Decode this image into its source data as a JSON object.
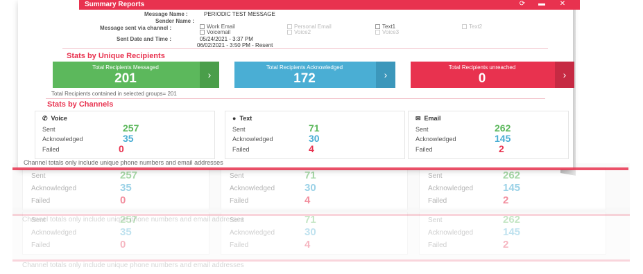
{
  "window": {
    "title": "Summary Reports",
    "icons": [
      "refresh-icon",
      "minimize-icon",
      "close-icon"
    ]
  },
  "meta": {
    "message_name_label": "Message Name :",
    "message_name_value": "PERIODIC TEST MESSAGE",
    "sender_name_label": "Sender Name :",
    "channels_label": "Message sent via channel :",
    "sent_label": "Sent Date and Time :",
    "sent_value_1": "05/24/2021 - 3:37 PM",
    "sent_value_2": "06/02/2021 - 3:50 PM - Resent"
  },
  "channels": {
    "work_email": "Work Email",
    "voicemail": "Voicemail",
    "personal_email": "Personal Email",
    "voice2": "Voice2",
    "text1": "Text1",
    "voice3": "Voice3",
    "text2": "Text2"
  },
  "unique": {
    "title": "Stats by Unique Recipients",
    "messaged_label": "Total Recipients Messaged",
    "messaged_value": "201",
    "ack_label": "Total Recipients Acknowledged",
    "ack_value": "172",
    "unreached_label": "Total Recipients unreached",
    "unreached_value": "0",
    "groups_note": "Total Recipients contained in selected groups= 201"
  },
  "by_channel": {
    "title": "Stats by Channels",
    "sent_label": "Sent",
    "ack_label": "Acknowledged",
    "failed_label": "Failed",
    "voice": {
      "name": "Voice",
      "sent": "257",
      "ack": "35",
      "failed": "0"
    },
    "text": {
      "name": "Text",
      "sent": "71",
      "ack": "30",
      "failed": "4"
    },
    "email": {
      "name": "Email",
      "sent": "262",
      "ack": "145",
      "failed": "2"
    },
    "footnote": "Channel totals only include unique phone numbers and email addresses"
  },
  "colors": {
    "accent": "#e8324f",
    "green": "#5cb85c",
    "blue": "#4aaed4",
    "tile_green": "#5cb85c",
    "tile_blue": "#4aaed4",
    "tile_red": "#e8324f"
  }
}
